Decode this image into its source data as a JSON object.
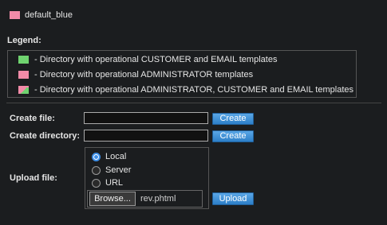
{
  "directory": {
    "name": "default_blue",
    "icon": "folder-icon",
    "color": "#f28ba8"
  },
  "legend": {
    "title": "Legend:",
    "items": [
      {
        "icon": "green-folder-icon",
        "color": "#6fd36f",
        "text": "- Directory with operational CUSTOMER and EMAIL templates"
      },
      {
        "icon": "pink-folder-icon",
        "color": "#f28ba8",
        "text": "- Directory with operational ADMINISTRATOR templates"
      },
      {
        "icon": "pink-green-folder-icon",
        "color": "#f28ba8/#6fd36f",
        "text": "- Directory with operational ADMINISTRATOR, CUSTOMER and EMAIL templates"
      }
    ]
  },
  "create_file": {
    "label": "Create file:",
    "value": "",
    "button": "Create"
  },
  "create_directory": {
    "label": "Create directory:",
    "value": "",
    "button": "Create"
  },
  "upload": {
    "label": "Upload file:",
    "source_options": [
      "Local",
      "Server",
      "URL"
    ],
    "selected_source": "Local",
    "browse_label": "Browse...",
    "file_name": "rev.phtml",
    "button": "Upload"
  },
  "colors": {
    "background": "#1b1d1f",
    "accent_button": "#2d7fc8"
  }
}
